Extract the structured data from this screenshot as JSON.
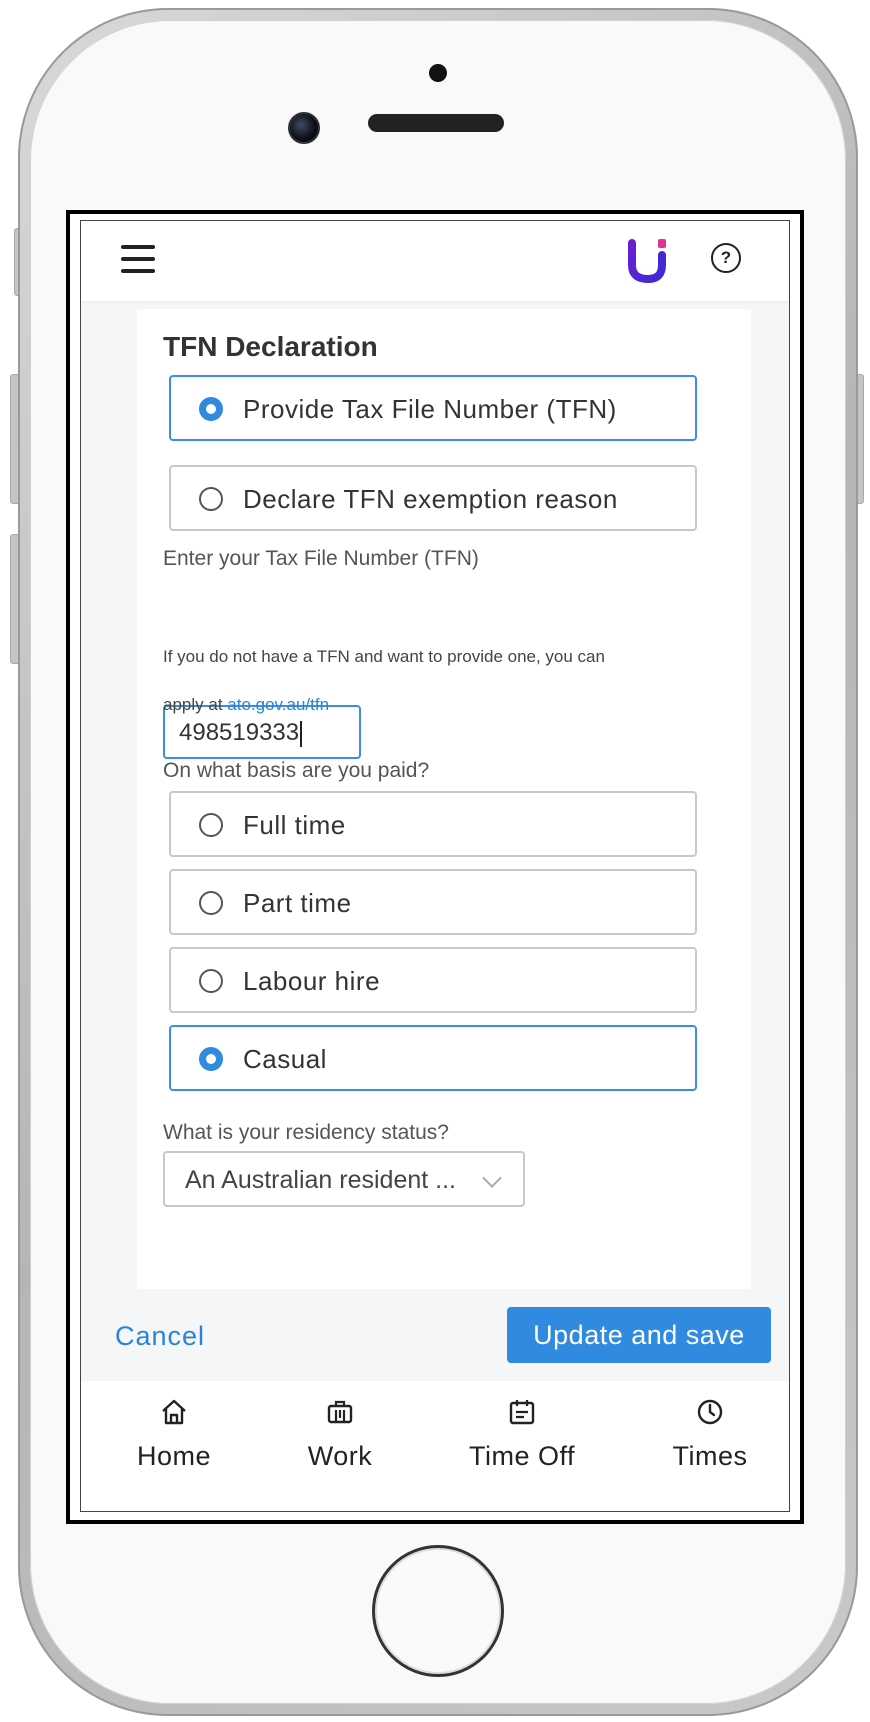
{
  "topbar": {
    "menu_icon": "hamburger-menu-icon",
    "logo_icon": "app-logo",
    "help_icon": "help-question-icon",
    "help_symbol": "?"
  },
  "form": {
    "title": "TFN Declaration",
    "tfn_options": [
      {
        "label": "Provide Tax File Number (TFN)",
        "selected": true
      },
      {
        "label": "Declare TFN exemption reason",
        "selected": false
      }
    ],
    "tfn_label": "Enter your Tax File Number (TFN)",
    "tfn_value": "498519333",
    "help_line1": "If you do not have a TFN and want to provide one, you can",
    "help_line2_prefix": "apply at ",
    "help_link": "ato.gov.au/tfn",
    "basis_label": "On what basis are you paid?",
    "basis_options": [
      {
        "label": "Full time",
        "selected": false
      },
      {
        "label": "Part time",
        "selected": false
      },
      {
        "label": "Labour hire",
        "selected": false
      },
      {
        "label": "Casual",
        "selected": true
      }
    ],
    "residency_label": "What is your residency status?",
    "residency_value": "An Australian resident ..."
  },
  "actions": {
    "cancel_label": "Cancel",
    "save_label": "Update and save"
  },
  "nav": {
    "items": [
      {
        "label": "Home",
        "icon": "home-icon"
      },
      {
        "label": "Work",
        "icon": "briefcase-icon"
      },
      {
        "label": "Time Off",
        "icon": "calendar-icon"
      },
      {
        "label": "Times",
        "icon": "clock-icon"
      }
    ]
  },
  "colors": {
    "accent": "#2f8ae0",
    "link": "#2a83d8",
    "logo_purple": "#6a1fd1",
    "logo_pink": "#e0338f"
  }
}
